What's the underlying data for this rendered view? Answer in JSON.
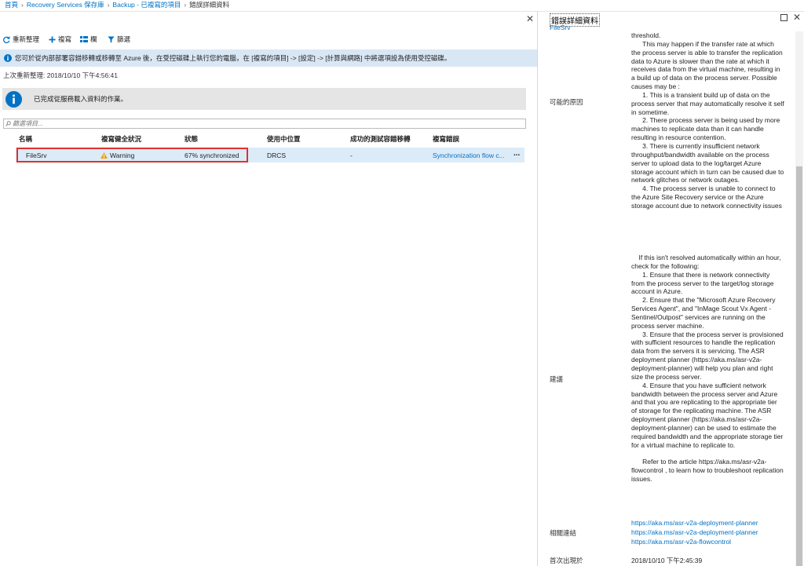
{
  "breadcrumb": {
    "items": [
      "首頁",
      "Recovery Services 保存庫",
      "Backup - 已複寫的項目"
    ],
    "current": "錯誤詳細資料"
  },
  "left_blade": {
    "toolbar": {
      "refresh": "重新整理",
      "replicate": "複寫",
      "columns": "欄",
      "filter": "篩選"
    },
    "info_banner": "您可於從內部部署容錯移轉或移轉至 Azure 後，在受控磁碟上執行您的電腦，在 [複寫的項目] -> [設定] -> [計算與網路] 中將選項設為使用受控磁碟。",
    "last_refresh": "上次重新整理: 2018/10/10 下午4:56:41",
    "job_notice": "已完成從服務載入資料的作業。",
    "filter_placeholder": "篩選項目...",
    "columns": [
      "名稱",
      "複寫健全狀況",
      "狀態",
      "使用中位置",
      "成功的測試容錯移轉",
      "複寫錯誤"
    ],
    "row": {
      "name": "FileSrv",
      "health": "Warning",
      "status": "67% synchronized",
      "location": "DRCS",
      "test_failover": "-",
      "error": "Synchronization flow c...",
      "more": "..."
    }
  },
  "right_blade": {
    "title": "錯誤詳細資料",
    "subtitle": "FileSrv",
    "cause_label": "可能的原因",
    "cause_text": "threshold.\n      This may happen if the transfer rate at which the process server is able to transfer the replication data to Azure is slower than the rate at which it receives data from the virtual machine, resulting in a build up of data on the process server. Possible causes may be :\n      1. This is a transient build up of data on the process server that may automatically resolve it self in sometime.\n      2. There process server is being used by more machines to replicate data than it can handle resulting in resource contention.\n      3. There is currently insufficient network throughput/bandwidth available on the process server to upload data to the log/target Azure storage account which in turn can be caused due to network glitches or network outages.\n      4. The process server is unable to connect to the Azure Site Recovery service or the Azure storage account due to network connectivity issues",
    "recommendation_label": "建議",
    "recommendation_text": "    If this isn't resolved automatically within an hour, check for the following:\n      1. Ensure that there is network connectivity from the process server to the target/log storage account in Azure.\n      2. Ensure that the \"Microsoft Azure Recovery Services Agent\", and \"InMage Scout Vx Agent - Sentinel/Outpost\" services are running on the process server machine.\n      3. Ensure that the process server is provisioned with sufficient resources to handle the replication data from the servers it is servicing. The ASR deployment planner (https://aka.ms/asr-v2a-deployment-planner) will help you plan and right size the process server.\n      4. Ensure that you have sufficient network bandwidth between the process server and Azure and that you are replicating to the appropriate tier of storage for the replicating machine. The ASR deployment planner (https://aka.ms/asr-v2a-deployment-planner) can be used to estimate the required bandwidth and the appropriate storage tier for a virtual machine to replicate to.\n\n      Refer to the article https://aka.ms/asr-v2a-flowcontrol , to learn how to troubleshoot replication issues.",
    "links_label": "相關連結",
    "links": [
      "https://aka.ms/asr-v2a-deployment-planner",
      "https://aka.ms/asr-v2a-deployment-planner",
      "https://aka.ms/asr-v2a-flowcontrol"
    ],
    "first_seen_label": "首次出現於",
    "first_seen_value": "2018/10/10 下午2:45:39"
  },
  "colors": {
    "link": "#0072c6",
    "info_banner_bg": "#d9e7f5",
    "row_selected_bg": "#dcebf8",
    "highlight_border": "#e0312f",
    "warning": "#e8a317",
    "info_icon": "#0072c6"
  }
}
